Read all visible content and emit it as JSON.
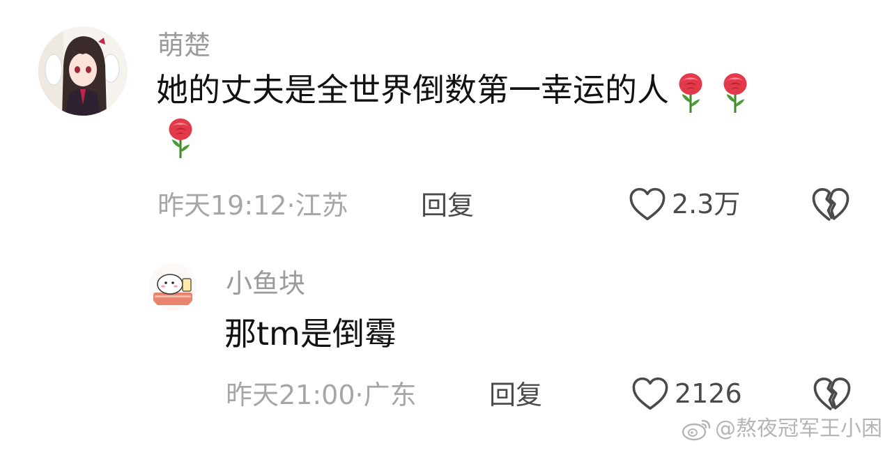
{
  "comments": [
    {
      "username": "萌楚",
      "text": "她的丈夫是全世界倒数第一幸运的人",
      "emojis": [
        "rose",
        "rose",
        "rose"
      ],
      "time": "昨天19:12",
      "location": "江苏",
      "meta": "昨天19:12·江苏",
      "reply_label": "回复",
      "like_count": "2.3万",
      "avatar": "anime-girl-avatar"
    },
    {
      "username": "小鱼块",
      "text": "那tm是倒霉",
      "time": "昨天21:00",
      "location": "广东",
      "meta": "昨天21:00·广东",
      "reply_label": "回复",
      "like_count": "2126",
      "avatar": "cartoon-hamster-avatar"
    }
  ],
  "watermark": {
    "text": "@熬夜冠军王小困",
    "icon": "weibo-icon"
  },
  "colors": {
    "username": "#9b9b9b",
    "meta": "#a6a6a6",
    "action": "#4a4a4a",
    "rose": "#e23a4a"
  }
}
